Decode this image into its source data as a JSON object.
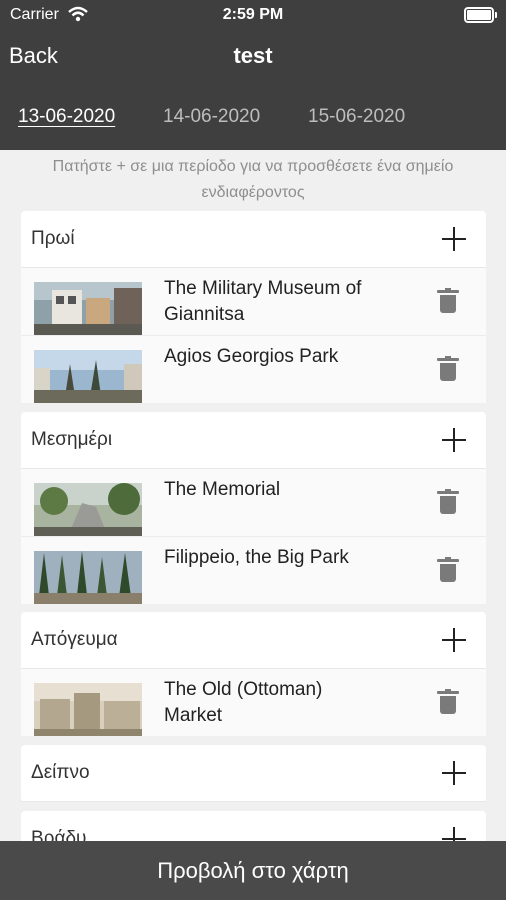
{
  "status_bar": {
    "carrier": "Carrier",
    "time": "2:59 PM"
  },
  "nav": {
    "back_label": "Back",
    "title": "test"
  },
  "date_tabs": [
    "13-06-2020",
    "14-06-2020",
    "15-06-2020"
  ],
  "hint": "Πατήστε + σε μια περίοδο για να προσθέσετε ένα σημείο ενδιαφέροντος",
  "sections": [
    {
      "name": "Πρωί",
      "items": [
        "The Military Museum of Giannitsa",
        "Agios Georgios Park"
      ]
    },
    {
      "name": "Μεσημέρι",
      "items": [
        "The Memorial",
        "Filippeio, the Big Park"
      ]
    },
    {
      "name": "Απόγευμα",
      "items": [
        "The Old (Ottoman) Market"
      ]
    },
    {
      "name": "Δείπνο",
      "items": []
    },
    {
      "name": "Βράδυ",
      "items": []
    }
  ],
  "map_button_label": "Προβολή στο χάρτη",
  "colors": {
    "header_bg": "#3f3f3f",
    "bottom_bar_bg": "#4a4a4a",
    "page_bg": "#f0f0f0"
  }
}
